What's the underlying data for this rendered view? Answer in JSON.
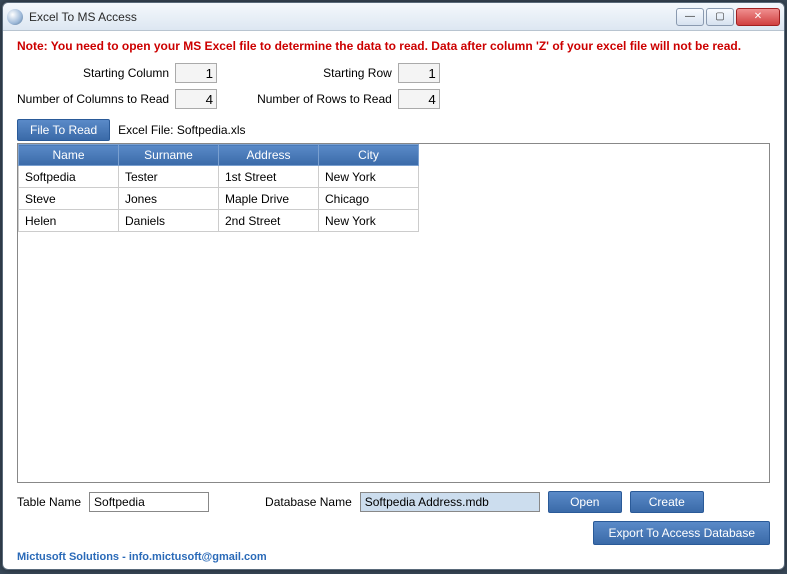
{
  "window": {
    "title": "Excel To MS Access"
  },
  "note": "Note:  You need to open your MS Excel file to determine the data to read. Data after column 'Z' of your excel file will not be read.",
  "params": {
    "start_col_label": "Starting Column",
    "start_col_value": "1",
    "num_cols_label": "Number of Columns to Read",
    "num_cols_value": "4",
    "start_row_label": "Starting Row",
    "start_row_value": "1",
    "num_rows_label": "Number of Rows to Read",
    "num_rows_value": "4"
  },
  "file": {
    "button": "File To Read",
    "label_prefix": "Excel File: ",
    "name": "Softpedia.xls"
  },
  "grid": {
    "headers": [
      "Name",
      "Surname",
      "Address",
      "City"
    ],
    "rows": [
      [
        "Softpedia",
        "Tester",
        "1st Street",
        "New York"
      ],
      [
        "Steve",
        "Jones",
        "Maple Drive",
        "Chicago"
      ],
      [
        "Helen",
        "Daniels",
        "2nd Street",
        "New York"
      ]
    ]
  },
  "bottom": {
    "table_name_label": "Table Name",
    "table_name_value": "Softpedia",
    "db_name_label": "Database Name",
    "db_name_value": "Softpedia Address.mdb",
    "open_btn": "Open",
    "create_btn": "Create"
  },
  "export_btn": "Export To Access Database",
  "footer": "Mictusoft Solutions - info.mictusoft@gmail.com"
}
